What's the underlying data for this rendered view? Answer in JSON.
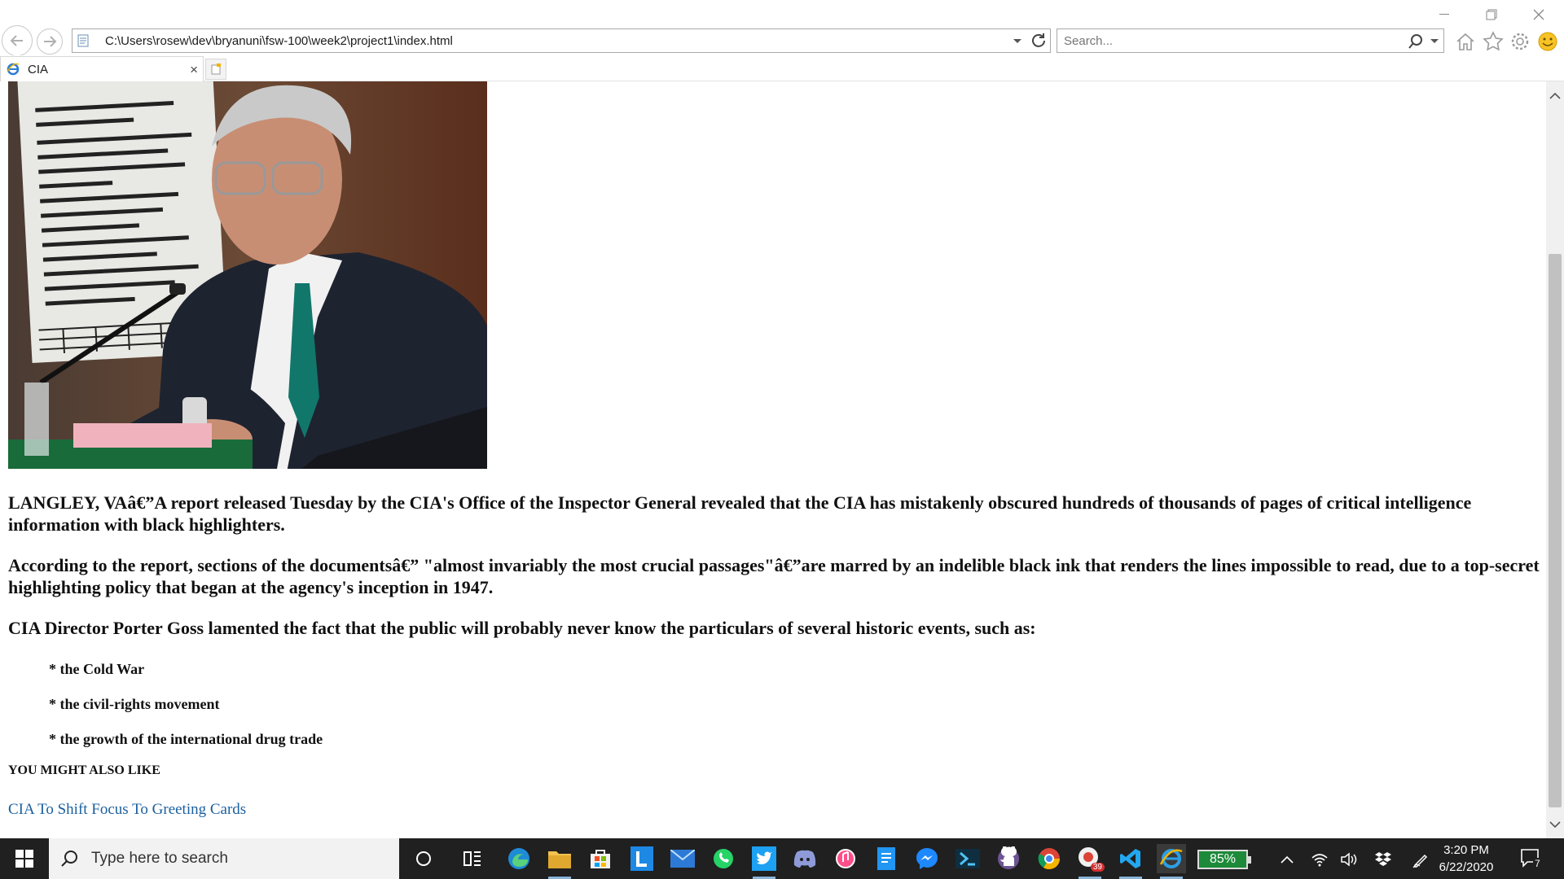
{
  "browser": {
    "address_url": "C:\\Users\\rosew\\dev\\bryanuni\\fsw-100\\week2\\project1\\index.html",
    "search_placeholder": "Search...",
    "tab_title": "CIA"
  },
  "article": {
    "paragraph1": "LANGLEY, VAâ€”A report released Tuesday by the CIA's Office of the Inspector General revealed that the CIA has mistakenly obscured hundreds of thousands of pages of critical intelligence information with black highlighters.",
    "paragraph2": "According to the report, sections of the documentsâ€” \"almost invariably the most crucial passages\"â€”are marred by an indelible black ink that renders the lines impossible to read, due to a top-secret highlighting policy that began at the agency's inception in 1947.",
    "paragraph3": "CIA Director Porter Goss lamented the fact that the public will probably never know the particulars of several historic events, such as:",
    "bullets": [
      "* the Cold War",
      "* the civil-rights movement",
      "* the growth of the international drug trade"
    ],
    "also_heading": "YOU MIGHT ALSO LIKE",
    "related_link": "CIA To Shift Focus To Greeting Cards"
  },
  "taskbar": {
    "search_text": "Type here to search",
    "battery_percent": "85%",
    "time": "3:20 PM",
    "date": "6/22/2020",
    "chrome_badge": "39",
    "notification_count": "7"
  },
  "colors": {
    "link": "#1a5f9e",
    "taskbar_bg": "#202020",
    "battery_fill": "#1d8a3a"
  }
}
